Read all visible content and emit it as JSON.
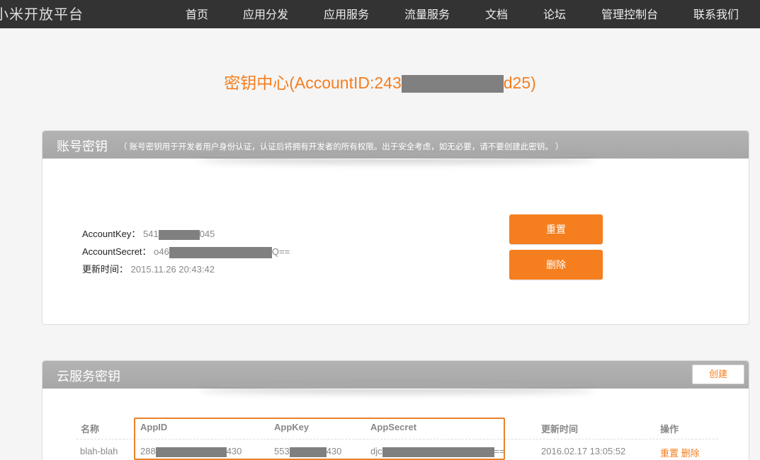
{
  "nav": {
    "brand": "小米开放平台",
    "items": [
      "首页",
      "应用分发",
      "应用服务",
      "流量服务",
      "文档",
      "论坛",
      "管理控制台",
      "联系我们"
    ]
  },
  "page": {
    "title_prefix": "密钥中心(AccountID:243",
    "title_suffix": "d25)"
  },
  "account_panel": {
    "title": "账号密钥",
    "note": "（ 账号密钥用于开发者用户身份认证，认证后将拥有开发者的所有权限。出于安全考虑，如无必要，请不要创建此密钥。 ）",
    "key_label": "AccountKey：",
    "key_prefix": "541",
    "key_suffix": "045",
    "secret_label": "AccountSecret：",
    "secret_prefix": "o46",
    "secret_suffix": "Q==",
    "time_label": "更新时间：",
    "time_value": "2015.11.26 20:43:42",
    "reset_label": "重置",
    "delete_label": "删除"
  },
  "cloud_panel": {
    "title": "云服务密钥",
    "create_label": "创建",
    "columns": [
      "名称",
      "AppID",
      "AppKey",
      "AppSecret",
      "更新时间",
      "操作"
    ],
    "row": {
      "name": "blah-blah",
      "appid_prefix": "288",
      "appid_suffix": "430",
      "appkey_prefix": "553",
      "appkey_suffix": "430",
      "appsecret_prefix": "djc",
      "appsecret_suffix": "==",
      "updated": "2016.02.17 13:05:52",
      "reset_label": "重置",
      "delete_label": "删除"
    }
  },
  "colors": {
    "accent": "#f57e1e",
    "nav_bg": "#333333",
    "panel_head": "#aaaaaa",
    "mask": "#808080"
  }
}
